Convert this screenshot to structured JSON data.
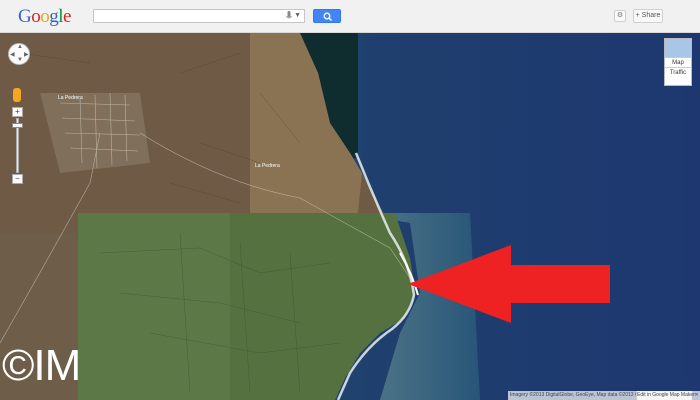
{
  "header": {
    "logo_text": "Google",
    "search": {
      "value": "",
      "placeholder": ""
    },
    "settings_icon": "gear-icon",
    "share_label": "+ Share"
  },
  "map_controls": {
    "pan_icon": "pan-control-icon",
    "pegman_icon": "street-view-pegman-icon",
    "zoom_in": "+",
    "zoom_out": "−",
    "maptype": {
      "selected": "Map",
      "traffic": "Traffic"
    }
  },
  "map": {
    "imagery": "satellite",
    "town_label": "La Pedrera",
    "beach_label": "La Pedrera",
    "annotation": {
      "type": "red-arrow-pointing-left",
      "color": "#ee2222"
    },
    "ocean_color": "#1e3a6e",
    "land_color": "#5a6b3f"
  },
  "watermark": "©IM",
  "footer": {
    "attribution": "Imagery ©2013 DigitalGlobe, GeoEye, Map data ©2013 Google",
    "edit_label": "Edit in Google Map Maker"
  }
}
